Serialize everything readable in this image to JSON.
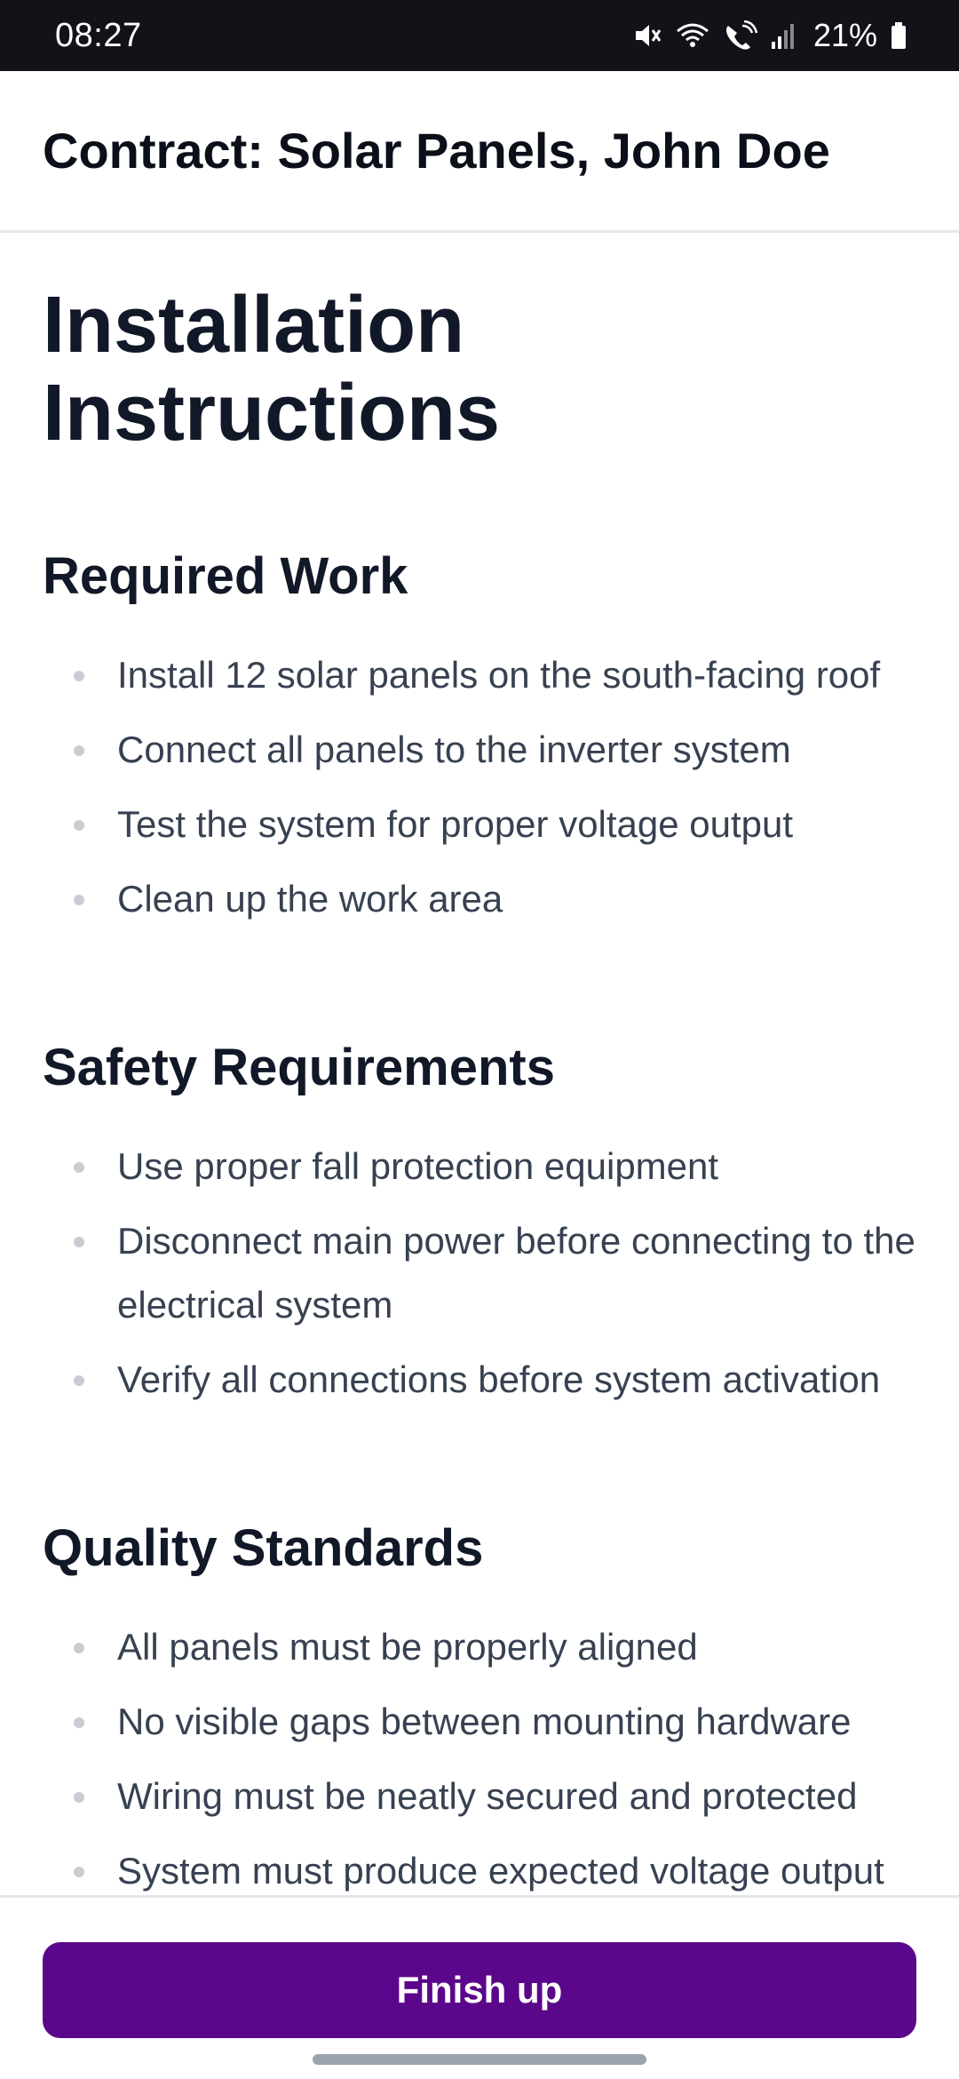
{
  "status_bar": {
    "time": "08:27",
    "battery": "21%",
    "icons": [
      "mute-icon",
      "wifi-icon",
      "wifi-call-icon",
      "signal-icon",
      "battery-icon"
    ]
  },
  "header": {
    "title": "Contract: Solar Panels, John Doe"
  },
  "main": {
    "title": "Installation Instructions",
    "sections": [
      {
        "heading": "Required Work",
        "items": [
          "Install 12 solar panels on the south-facing roof",
          "Connect all panels to the inverter system",
          "Test the system for proper voltage output",
          "Clean up the work area"
        ]
      },
      {
        "heading": "Safety Requirements",
        "items": [
          "Use proper fall protection equipment",
          "Disconnect main power before connecting to the electrical system",
          "Verify all connections before system activation"
        ]
      },
      {
        "heading": "Quality Standards",
        "items": [
          "All panels must be properly aligned",
          "No visible gaps between mounting hardware",
          "Wiring must be neatly secured and protected",
          "System must produce expected voltage output"
        ]
      }
    ]
  },
  "footer": {
    "finish_label": "Finish up"
  },
  "colors": {
    "button_bg": "#5b078b",
    "status_bar_bg": "#121218"
  }
}
